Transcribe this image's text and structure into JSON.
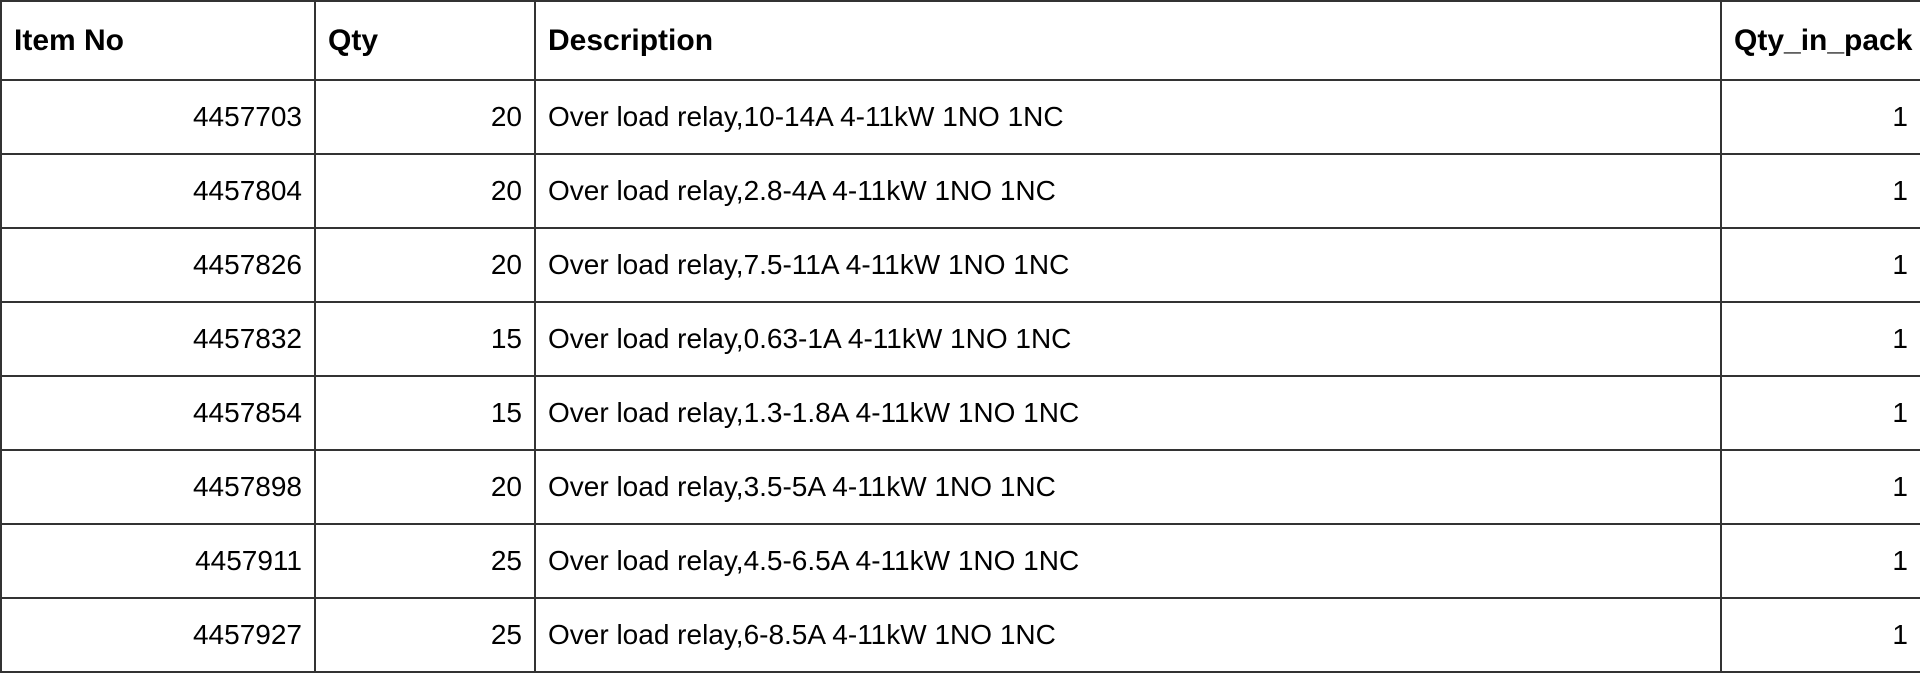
{
  "table": {
    "headers": {
      "item_no": "Item No",
      "qty": "Qty",
      "description": "Description",
      "qty_in_pack": "Qty_in_pack"
    },
    "rows": [
      {
        "item_no": "4457703",
        "qty": "20",
        "description": "Over load relay,10-14A 4-11kW 1NO 1NC",
        "qty_in_pack": "1"
      },
      {
        "item_no": "4457804",
        "qty": "20",
        "description": "Over load relay,2.8-4A 4-11kW 1NO 1NC",
        "qty_in_pack": "1"
      },
      {
        "item_no": "4457826",
        "qty": "20",
        "description": "Over load relay,7.5-11A 4-11kW 1NO 1NC",
        "qty_in_pack": "1"
      },
      {
        "item_no": "4457832",
        "qty": "15",
        "description": "Over load relay,0.63-1A 4-11kW 1NO 1NC",
        "qty_in_pack": "1"
      },
      {
        "item_no": "4457854",
        "qty": "15",
        "description": "Over load relay,1.3-1.8A 4-11kW 1NO 1NC",
        "qty_in_pack": "1"
      },
      {
        "item_no": "4457898",
        "qty": "20",
        "description": "Over load relay,3.5-5A 4-11kW 1NO 1NC",
        "qty_in_pack": "1"
      },
      {
        "item_no": "4457911",
        "qty": "25",
        "description": "Over load relay,4.5-6.5A 4-11kW 1NO 1NC",
        "qty_in_pack": "1"
      },
      {
        "item_no": "4457927",
        "qty": "25",
        "description": "Over load relay,6-8.5A 4-11kW 1NO 1NC",
        "qty_in_pack": "1"
      }
    ]
  }
}
